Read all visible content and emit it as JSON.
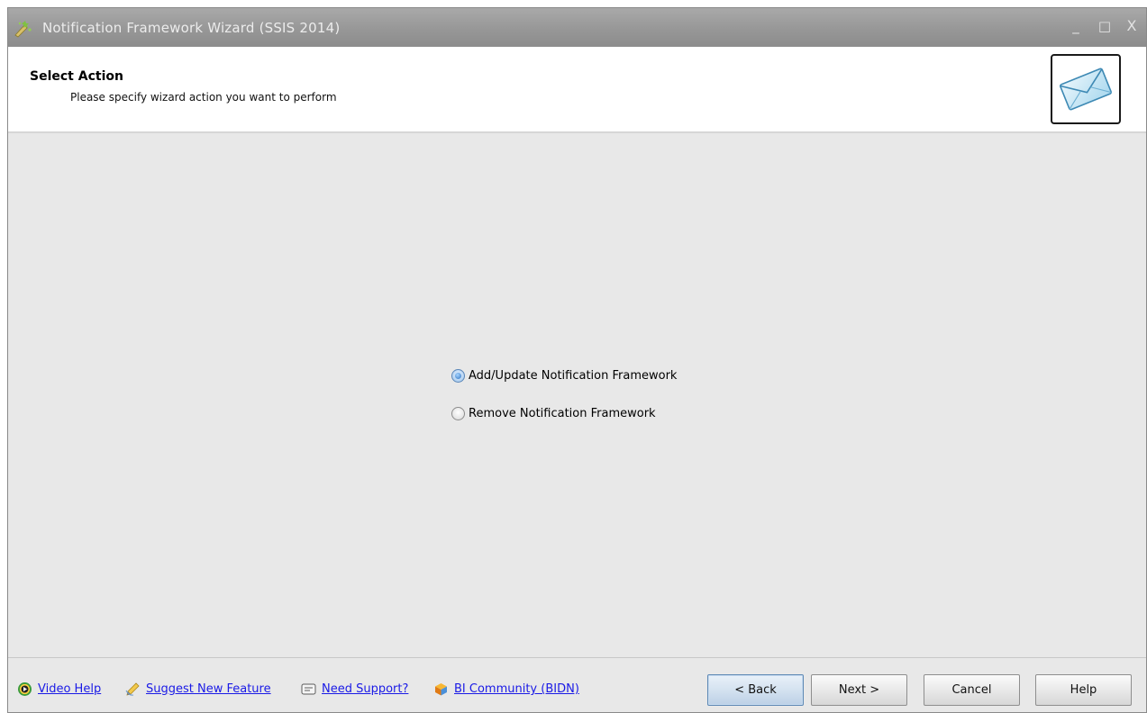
{
  "window": {
    "title": "Notification Framework Wizard (SSIS 2014)",
    "controls": {
      "minimize": "_",
      "maximize": "□",
      "close": "X"
    }
  },
  "header": {
    "title": "Select Action",
    "subtitle": "Please specify wizard action you want to perform",
    "logo_icon": "envelope-icon"
  },
  "options": [
    {
      "label": "Add/Update Notification Framework",
      "selected": true
    },
    {
      "label": "Remove Notification Framework",
      "selected": false
    }
  ],
  "footer": {
    "links": [
      {
        "label": "Video Help",
        "icon": "video-play-icon"
      },
      {
        "label": "Suggest New Feature",
        "icon": "pen-icon"
      },
      {
        "label": "Need Support?",
        "icon": "support-icon"
      },
      {
        "label": "BI Community (BIDN)",
        "icon": "community-icon"
      }
    ],
    "buttons": {
      "back": "< Back",
      "next": "Next >",
      "cancel": "Cancel",
      "help": "Help"
    }
  },
  "colors": {
    "link": "#1a1ae6",
    "titlebar": "#979797",
    "body": "#e8e8e8"
  }
}
